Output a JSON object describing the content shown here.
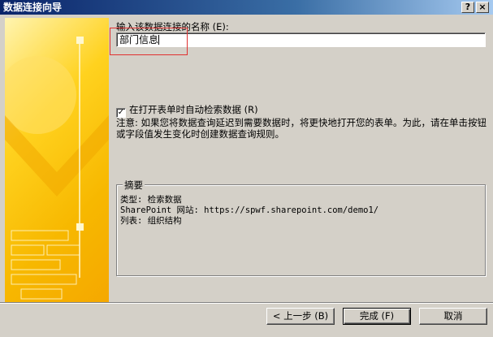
{
  "window": {
    "title": "数据连接向导",
    "help_label": "?",
    "close_label": "×"
  },
  "form": {
    "name_label": "输入该数据连接的名称 (E):",
    "name_value": "部门信息",
    "auto_retrieve_label": "在打开表单时自动检索数据 (R)",
    "auto_retrieve_checked": true,
    "check_mark": "✓",
    "note": "注意: 如果您将数据查询延迟到需要数据时，将更快地打开您的表单。为此，请在单击按钮或字段值发生变化时创建数据查询规则。"
  },
  "summary": {
    "legend": "摘要",
    "lines": [
      "类型: 检索数据",
      "SharePoint 网站: https://spwf.sharepoint.com/demo1/",
      "列表: 组织结构"
    ]
  },
  "buttons": {
    "prev": "< 上一步 (B)",
    "finish": "完成 (F)",
    "cancel": "取消"
  },
  "colors": {
    "art_primary": "#f7b800",
    "art_light": "#fff4b0",
    "highlight_box": "#e03030"
  }
}
